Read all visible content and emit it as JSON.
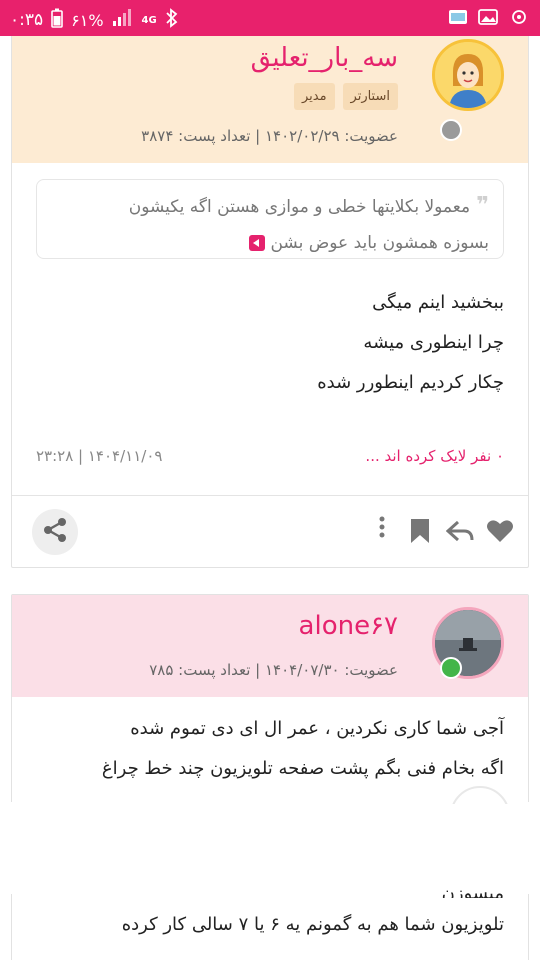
{
  "status_bar": {
    "time": "۰:۳۵",
    "battery": "۶۱%",
    "network": "4G",
    "colors": {
      "bar": "#e8216c"
    },
    "icons": [
      "battery-icon",
      "signal-icon",
      "network-4g-icon",
      "bluetooth-icon",
      "photo-icon",
      "gallery-icon",
      "vpn-icon"
    ]
  },
  "post1": {
    "username": "سه_بار_تعلیق",
    "badges": [
      "استارتر",
      "مدیر"
    ],
    "meta": "عضویت: ۱۴۰۲/۰۲/۲۹ | تعداد پست: ۳۸۷۴",
    "quote": {
      "line1": "معمولا بکلایتها خطی و موازی هستن اگه یکیشون",
      "line2": "بسوزه همشون باید عوض بشن"
    },
    "body": [
      "ببخشید اینم میگی",
      "چرا اینطوری میشه",
      "چکار کردیم اینطورر شده"
    ],
    "likes": "۰ نفر لایک کرده اند ...",
    "date": "۱۴۰۴/۱۱/۰۹ | ۲۳:۲۸",
    "colors": {
      "header": "#fdebd3",
      "accent": "#e5226d"
    }
  },
  "post2": {
    "username": "alone۶۷",
    "meta": "عضویت: ۱۴۰۴/۰۷/۳۰ | تعداد پست: ۷۸۵",
    "body": [
      "آجی شما کاری نکردین ، عمر ال ای دی تموم شده",
      "اگه بخام فنی بگم پشت صفحه تلویزیون چند خط چراغ"
    ],
    "cut_text": "میسوزن",
    "last_line": "تلویزیون شما هم به گمونم یه ۶ یا ۷ سالی کار کرده",
    "colors": {
      "header": "#fbdfe7",
      "online": "#43b549"
    }
  }
}
